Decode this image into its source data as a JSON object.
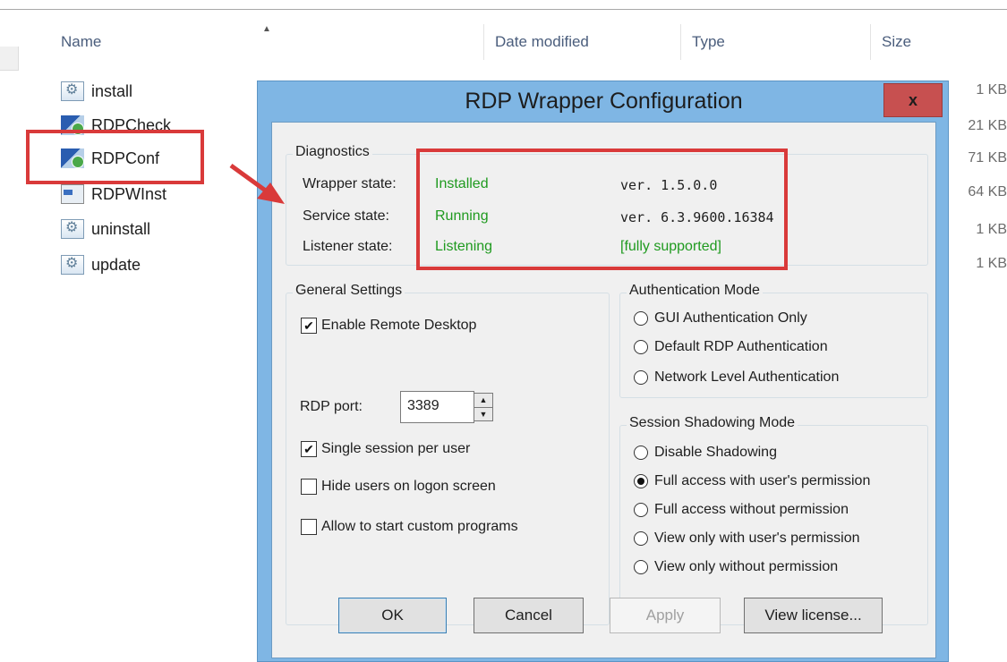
{
  "explorer": {
    "columns": {
      "name": "Name",
      "date_modified": "Date modified",
      "type": "Type",
      "size": "Size"
    },
    "files": [
      {
        "name": "install",
        "icon": "script-gear-icon"
      },
      {
        "name": "RDPCheck",
        "icon": "app-icon"
      },
      {
        "name": "RDPConf",
        "icon": "app-icon"
      },
      {
        "name": "RDPWInst",
        "icon": "installer-icon"
      },
      {
        "name": "uninstall",
        "icon": "script-gear-icon"
      },
      {
        "name": "update",
        "icon": "script-gear-icon"
      }
    ],
    "sizes": [
      "1 KB",
      "21 KB",
      "71 KB",
      "64 KB",
      "1 KB",
      "1 KB"
    ]
  },
  "dialog": {
    "title": "RDP Wrapper Configuration",
    "close_label": "x",
    "diagnostics": {
      "title": "Diagnostics",
      "wrapper_label": "Wrapper state:",
      "wrapper_value": "Installed",
      "wrapper_version": "ver. 1.5.0.0",
      "service_label": "Service state:",
      "service_value": "Running",
      "service_version": "ver. 6.3.9600.16384",
      "listener_label": "Listener state:",
      "listener_value": "Listening",
      "listener_support": "[fully supported]"
    },
    "general": {
      "title": "General Settings",
      "enable_rdp": "Enable Remote Desktop",
      "rdp_port_label": "RDP port:",
      "rdp_port_value": "3389",
      "single_session": "Single session per user",
      "hide_users": "Hide users on logon screen",
      "allow_custom": "Allow to start custom programs",
      "checked": {
        "enable_rdp": true,
        "single_session": true,
        "hide_users": false,
        "allow_custom": false
      }
    },
    "auth": {
      "title": "Authentication Mode",
      "options": [
        "GUI Authentication Only",
        "Default RDP Authentication",
        "Network Level Authentication"
      ]
    },
    "shadow": {
      "title": "Session Shadowing Mode",
      "options": [
        "Disable Shadowing",
        "Full access with user's permission",
        "Full access without permission",
        "View only with user's permission",
        "View only without permission"
      ],
      "selected_index": 1
    },
    "buttons": {
      "ok": "OK",
      "cancel": "Cancel",
      "apply": "Apply",
      "license": "View license..."
    }
  },
  "colors": {
    "status_green": "#1f9a1f",
    "highlight_red": "#d93a3a",
    "title_bar": "#7fb6e4",
    "close_red": "#c75050"
  }
}
